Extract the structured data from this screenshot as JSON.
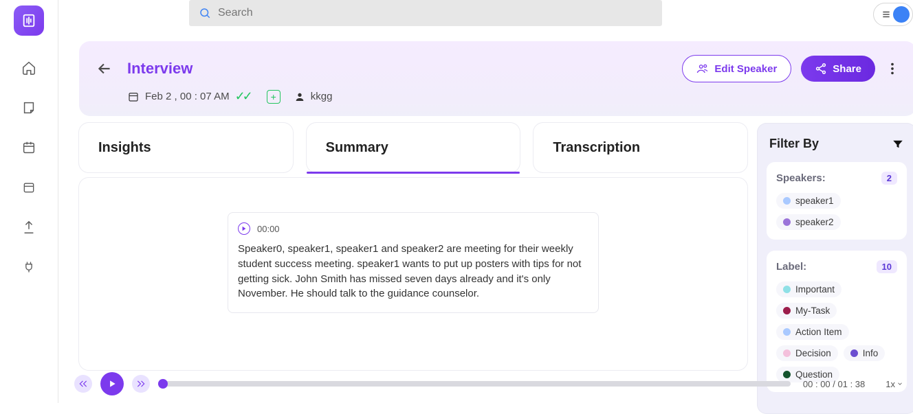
{
  "search": {
    "placeholder": "Search"
  },
  "title": "Interview",
  "meta": {
    "datetime": "Feb 2 , 00 : 07 AM",
    "user": "kkgg"
  },
  "actions": {
    "edit_speaker": "Edit Speaker",
    "share": "Share"
  },
  "tabs": {
    "insights": "Insights",
    "summary": "Summary",
    "transcription": "Transcription"
  },
  "summary": {
    "timestamp": "00:00",
    "text": "Speaker0, speaker1, speaker1 and speaker2 are meeting for their weekly student success meeting. speaker1 wants to put up posters with tips for not getting sick. John Smith has missed seven days already and it's only November. He should talk to the guidance counselor."
  },
  "filter": {
    "title": "Filter By",
    "speakers": {
      "label": "Speakers:",
      "count": "2",
      "items": [
        {
          "name": "speaker1",
          "color": "#a9c9ff"
        },
        {
          "name": "speaker2",
          "color": "#9b74d9"
        }
      ]
    },
    "labels": {
      "label": "Label:",
      "count": "10",
      "items": [
        {
          "name": "Important",
          "color": "#8fe0e6"
        },
        {
          "name": "My-Task",
          "color": "#9c1d4b"
        },
        {
          "name": "Action Item",
          "color": "#a9c9ff"
        },
        {
          "name": "Decision",
          "color": "#f4c0dc"
        },
        {
          "name": "Info",
          "color": "#6b4ed0"
        },
        {
          "name": "Question",
          "color": "#14532d"
        }
      ]
    }
  },
  "player": {
    "time": "00 : 00 / 01 : 38",
    "speed": "1x"
  }
}
